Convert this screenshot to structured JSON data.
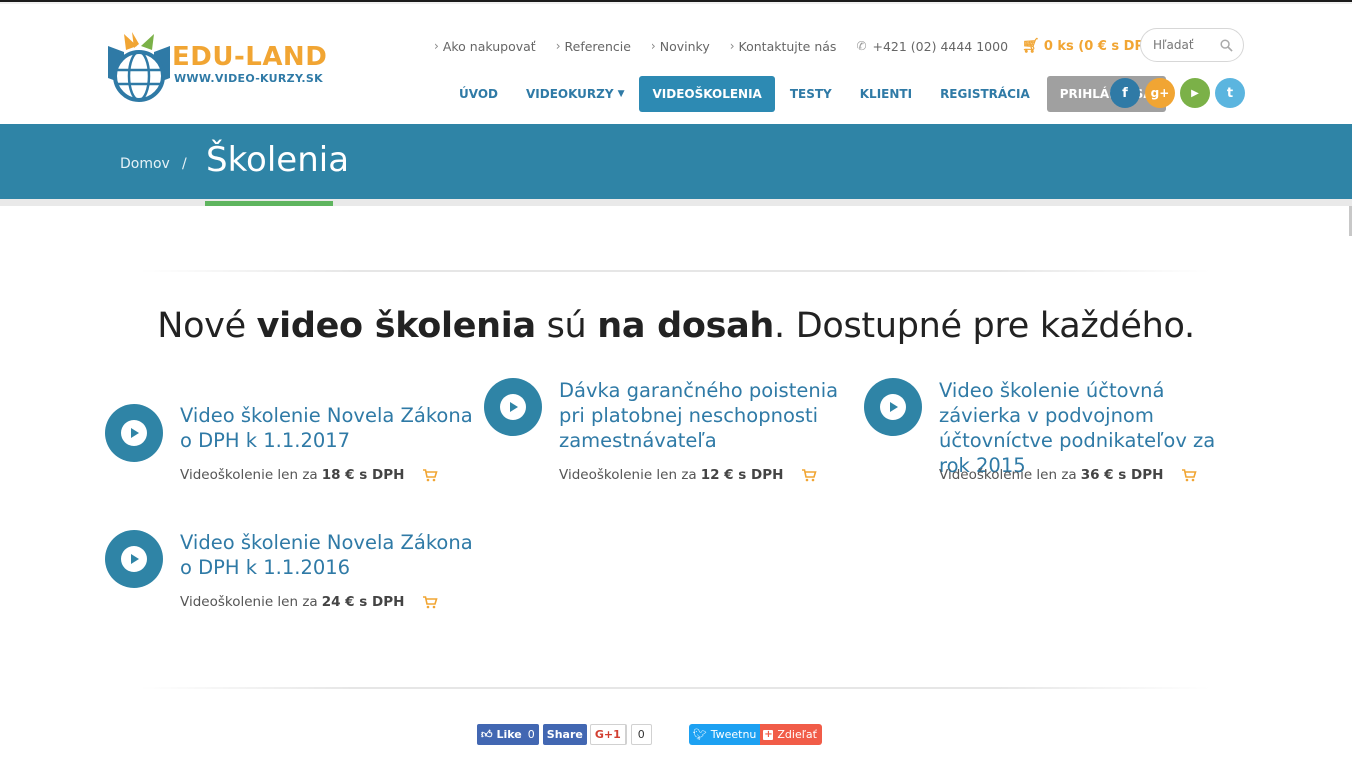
{
  "logo": {
    "name": "EDU-LAND",
    "url_text": "WWW.VIDEO-KURZY.SK"
  },
  "utility_nav": {
    "items": [
      "Ako nakupovať",
      "Referencie",
      "Novinky",
      "Kontaktujte nás"
    ],
    "phone": "+421 (02) 4444 1000",
    "cart": "0 ks (0 € s DPH)",
    "search_placeholder": "Hľadať"
  },
  "main_nav": {
    "items": [
      "ÚVOD",
      "VIDEOKURZY",
      "VIDEOŠKOLENIA",
      "TESTY",
      "KLIENTI",
      "REGISTRÁCIA"
    ],
    "active": "VIDEOŠKOLENIA",
    "login": "PRIHLÁSIŤ SA"
  },
  "social": [
    {
      "icon": "facebook-icon",
      "glyph": "f",
      "color": "#2f7aa6"
    },
    {
      "icon": "google-plus-icon",
      "glyph": "g+",
      "color": "#f1a533"
    },
    {
      "icon": "youtube-icon",
      "glyph": "▶",
      "color": "#7bb148"
    },
    {
      "icon": "twitter-icon",
      "glyph": "t",
      "color": "#5bb5df"
    }
  ],
  "breadcrumb": {
    "home": "Domov",
    "separator": "/",
    "current": "Školenia"
  },
  "headline": {
    "p1": "Nové ",
    "b1": "video školenia",
    "p2": " sú ",
    "b2": "na dosah",
    "p3": ". Dostupné pre každého."
  },
  "courses": [
    {
      "title": "Video školenie Novela Zákona o DPH k 1.1.2017",
      "price_prefix": "Videoškolenie len za",
      "price": "18 € s DPH"
    },
    {
      "title": "Dávka garančného poistenia pri platobnej neschopnosti zamestnávateľa",
      "price_prefix": "Videoškolenie len za",
      "price": "12 € s DPH"
    },
    {
      "title": "Video školenie účtovná závierka v podvojnom účtovníctve podnikateľov za rok 2015",
      "price_prefix": "Videoškolenie len za",
      "price": "36 € s DPH"
    },
    {
      "title": "Video školenie Novela Zákona o DPH k 1.1.2016",
      "price_prefix": "Videoškolenie len za",
      "price": "24 € s DPH"
    }
  ],
  "share_bar": {
    "fb_like": "Like",
    "fb_like_count": "0",
    "fb_share": "Share",
    "gplus": "G+1",
    "gplus_count": "0",
    "tweet": "Tweetnu",
    "share": "Zdieľať"
  },
  "colors": {
    "primary": "#2f84a6",
    "accent": "#f1a533",
    "green": "#5fb55f"
  }
}
